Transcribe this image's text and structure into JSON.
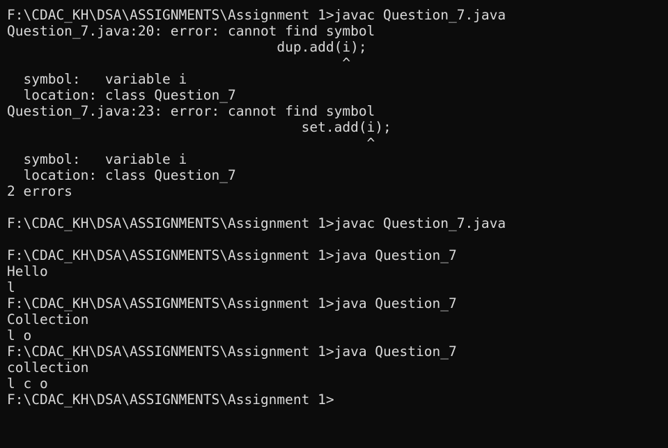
{
  "terminal": {
    "lines": [
      "F:\\CDAC_KH\\DSA\\ASSIGNMENTS\\Assignment 1>javac Question_7.java",
      "Question_7.java:20: error: cannot find symbol",
      "                                 dup.add(i);",
      "                                         ^",
      "  symbol:   variable i",
      "  location: class Question_7",
      "Question_7.java:23: error: cannot find symbol",
      "                                    set.add(i);",
      "                                            ^",
      "  symbol:   variable i",
      "  location: class Question_7",
      "2 errors",
      "",
      "F:\\CDAC_KH\\DSA\\ASSIGNMENTS\\Assignment 1>javac Question_7.java",
      "",
      "F:\\CDAC_KH\\DSA\\ASSIGNMENTS\\Assignment 1>java Question_7",
      "Hello",
      "l",
      "F:\\CDAC_KH\\DSA\\ASSIGNMENTS\\Assignment 1>java Question_7",
      "Collection",
      "l o",
      "F:\\CDAC_KH\\DSA\\ASSIGNMENTS\\Assignment 1>java Question_7",
      "collection",
      "l c o",
      "F:\\CDAC_KH\\DSA\\ASSIGNMENTS\\Assignment 1>"
    ]
  },
  "colors": {
    "background": "#0c0c0c",
    "foreground": "#d9d9d9"
  }
}
